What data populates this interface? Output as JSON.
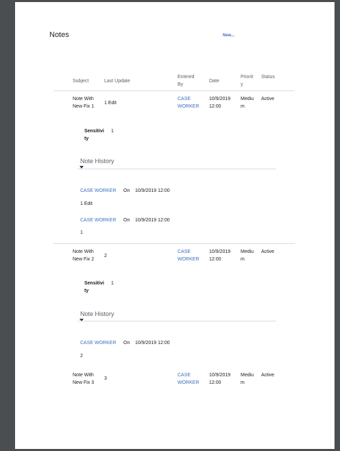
{
  "title": "Notes",
  "new_link": "New...",
  "columns": [
    "Subject",
    "Last Update",
    "Entered By",
    "Date",
    "Priority",
    "Status"
  ],
  "notes": [
    {
      "subject": "Note With New Fix 1",
      "last_update": "1 Edit",
      "entered_by": "CASE WORKER",
      "date": "10/9/2019 12:00",
      "priority": "Medium",
      "status": "Active",
      "sensitivity_label": "Sensitivity",
      "sensitivity": "1",
      "history_label": "Note History",
      "history": [
        {
          "user": "CASE WORKER",
          "on": "On",
          "date": "10/9/2019 12:00",
          "text": "1 Edit"
        },
        {
          "user": "CASE WORKER",
          "on": "On",
          "date": "10/9/2019 12:00",
          "text": "1"
        }
      ]
    },
    {
      "subject": "Note With New Fix 2",
      "last_update": "2",
      "entered_by": "CASE WORKER",
      "date": "10/9/2019 12:00",
      "priority": "Medium",
      "status": "Active",
      "sensitivity_label": "Sensitivity",
      "sensitivity": "1",
      "history_label": "Note History",
      "history": [
        {
          "user": "CASE WORKER",
          "on": "On",
          "date": "10/9/2019 12:00",
          "text": "2"
        }
      ]
    },
    {
      "subject": "Note With New Fix 3",
      "last_update": "3",
      "entered_by": "CASE WORKER",
      "date": "10/9/2019 12:00",
      "priority": "Medium",
      "status": "Active"
    }
  ]
}
